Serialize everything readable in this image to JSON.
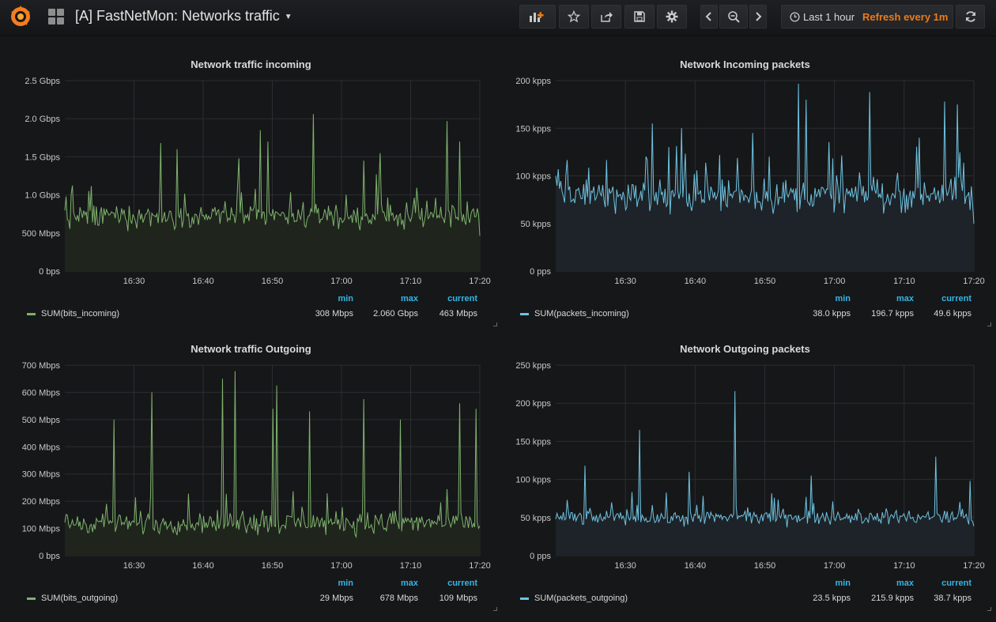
{
  "navbar": {
    "title": "[A] FastNetMon: Networks traffic",
    "time_range": "Last 1 hour",
    "refresh": "Refresh every 1m",
    "buttons": [
      "add-panel",
      "star",
      "share",
      "save",
      "settings",
      "time-back",
      "zoom-out",
      "time-forward",
      "refresh"
    ]
  },
  "colors": {
    "background": "#161719",
    "grid": "#2a2b2e",
    "green": "#7eb26d",
    "blue": "#6ec2e0",
    "legend_header": "#33b5e5",
    "refresh_accent": "#eb7b18"
  },
  "x_ticks": [
    "16:30",
    "16:40",
    "16:50",
    "17:00",
    "17:10",
    "17:20"
  ],
  "legend_headers": {
    "min": "min",
    "max": "max",
    "current": "current"
  },
  "panels": [
    {
      "title": "Network traffic incoming",
      "y_ticks": [
        "0 bps",
        "500 Mbps",
        "1.0 Gbps",
        "1.5 Gbps",
        "2.0 Gbps",
        "2.5 Gbps"
      ],
      "series": "SUM(bits_incoming)",
      "min": "308 Mbps",
      "max": "2.060 Gbps",
      "current": "463 Mbps",
      "color": "#7eb26d"
    },
    {
      "title": "Network Incoming packets",
      "y_ticks": [
        "0 pps",
        "50 kpps",
        "100 kpps",
        "150 kpps",
        "200 kpps"
      ],
      "series": "SUM(packets_incoming)",
      "min": "38.0 kpps",
      "max": "196.7 kpps",
      "current": "49.6 kpps",
      "color": "#6ec2e0"
    },
    {
      "title": "Network traffic Outgoing",
      "y_ticks": [
        "0 bps",
        "100 Mbps",
        "200 Mbps",
        "300 Mbps",
        "400 Mbps",
        "500 Mbps",
        "600 Mbps",
        "700 Mbps"
      ],
      "series": "SUM(bits_outgoing)",
      "min": "29 Mbps",
      "max": "678 Mbps",
      "current": "109 Mbps",
      "color": "#7eb26d"
    },
    {
      "title": "Network Outgoing packets",
      "y_ticks": [
        "0 pps",
        "50 kpps",
        "100 kpps",
        "150 kpps",
        "200 kpps",
        "250 kpps"
      ],
      "series": "SUM(packets_outgoing)",
      "min": "23.5 kpps",
      "max": "215.9 kpps",
      "current": "38.7 kpps",
      "color": "#6ec2e0"
    }
  ],
  "chart_data": [
    {
      "type": "line",
      "title": "Network traffic incoming",
      "series": [
        {
          "name": "SUM(bits_incoming)",
          "unit": "Mbps",
          "baseline": 720,
          "noise": 140,
          "spikes": [
            [
              0.23,
              1680
            ],
            [
              0.27,
              1600
            ],
            [
              0.42,
              1480
            ],
            [
              0.47,
              1850
            ],
            [
              0.49,
              1700
            ],
            [
              0.6,
              2060
            ],
            [
              0.72,
              1450
            ],
            [
              0.76,
              1550
            ],
            [
              0.92,
              1970
            ],
            [
              0.95,
              1700
            ]
          ],
          "current": 463
        }
      ],
      "x_range": [
        "16:20",
        "17:20"
      ],
      "ylim": [
        0,
        2500
      ],
      "min": 308,
      "max": 2060
    },
    {
      "type": "line",
      "title": "Network Incoming packets",
      "series": [
        {
          "name": "SUM(packets_incoming)",
          "unit": "kpps",
          "baseline": 80,
          "noise": 16,
          "spikes": [
            [
              0.23,
              155
            ],
            [
              0.3,
              150
            ],
            [
              0.47,
              145
            ],
            [
              0.58,
              196.7
            ],
            [
              0.6,
              180
            ],
            [
              0.75,
              188
            ],
            [
              0.87,
              140
            ],
            [
              0.93,
              178
            ],
            [
              0.96,
              175
            ]
          ],
          "current": 49.6
        }
      ],
      "x_range": [
        "16:20",
        "17:20"
      ],
      "ylim": [
        0,
        200
      ],
      "min": 38.0,
      "max": 196.7
    },
    {
      "type": "line",
      "title": "Network traffic Outgoing",
      "series": [
        {
          "name": "SUM(bits_outgoing)",
          "unit": "Mbps",
          "baseline": 120,
          "noise": 35,
          "spikes": [
            [
              0.12,
              500
            ],
            [
              0.21,
              600
            ],
            [
              0.38,
              650
            ],
            [
              0.41,
              678
            ],
            [
              0.5,
              540
            ],
            [
              0.51,
              625
            ],
            [
              0.59,
              530
            ],
            [
              0.72,
              575
            ],
            [
              0.81,
              500
            ],
            [
              0.95,
              560
            ],
            [
              0.99,
              540
            ]
          ],
          "current": 109
        }
      ],
      "x_range": [
        "16:20",
        "17:20"
      ],
      "ylim": [
        0,
        700
      ],
      "min": 29,
      "max": 678
    },
    {
      "type": "line",
      "title": "Network Outgoing packets",
      "series": [
        {
          "name": "SUM(packets_outgoing)",
          "unit": "kpps",
          "baseline": 50,
          "noise": 9,
          "spikes": [
            [
              0.07,
              118
            ],
            [
              0.2,
              165
            ],
            [
              0.32,
              110
            ],
            [
              0.43,
              215.9
            ],
            [
              0.61,
              105
            ],
            [
              0.91,
              130
            ],
            [
              0.99,
              98
            ]
          ],
          "current": 38.7
        }
      ],
      "x_range": [
        "16:20",
        "17:20"
      ],
      "ylim": [
        0,
        250
      ],
      "min": 23.5,
      "max": 215.9
    }
  ]
}
